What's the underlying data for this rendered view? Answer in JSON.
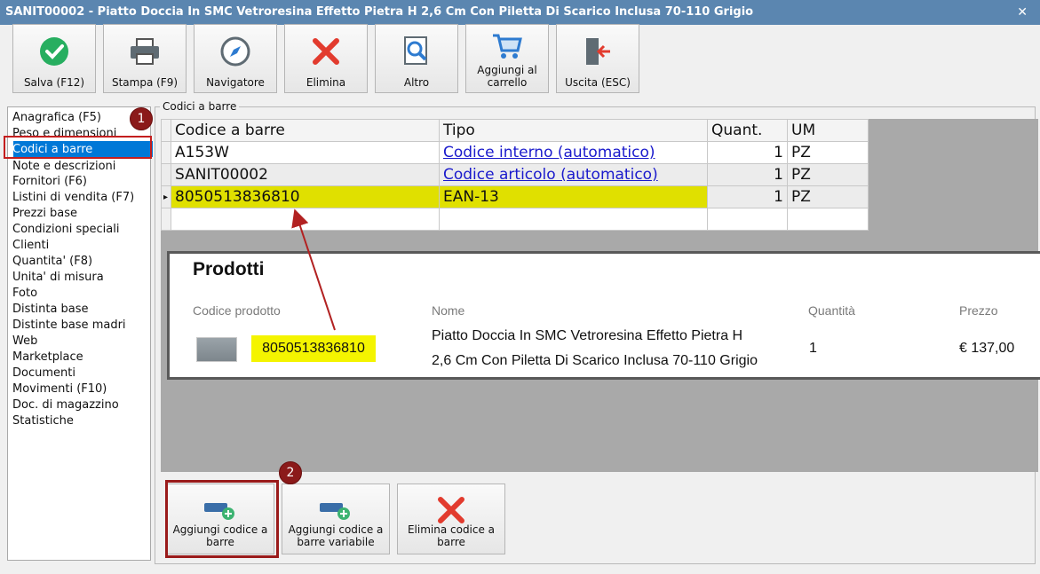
{
  "window": {
    "title": "SANIT00002 - Piatto Doccia In SMC Vetroresina Effetto Pietra H 2,6 Cm Con Piletta Di Scarico Inclusa 70-110 Grigio",
    "close_glyph": "✕"
  },
  "toolbar": {
    "save": "Salva (F12)",
    "print": "Stampa (F9)",
    "navigator": "Navigatore",
    "delete": "Elimina",
    "other": "Altro",
    "add_cart_line1": "Aggiungi al",
    "add_cart_line2": "carrello",
    "exit": "Uscita (ESC)"
  },
  "sidebar": {
    "items": [
      "Anagrafica (F5)",
      "Peso e dimensioni",
      "Codici a barre",
      "Note e descrizioni",
      "Fornitori (F6)",
      "Listini di vendita (F7)",
      "Prezzi base",
      "Condizioni speciali",
      "Clienti",
      "Quantita' (F8)",
      "Unita' di misura",
      "Foto",
      "Distinta base",
      "Distinte base madri",
      "Web",
      "Marketplace",
      "Documenti",
      "Movimenti (F10)",
      "Doc. di magazzino",
      "Statistiche"
    ],
    "selected": "Codici a barre"
  },
  "badges": {
    "one": "1",
    "two": "2"
  },
  "group": {
    "title": "Codici a barre"
  },
  "grid": {
    "columns": [
      "Codice a barre",
      "Tipo",
      "Quant.",
      "UM"
    ],
    "rows": [
      {
        "code": "A153W",
        "type": "Codice interno (automatico)",
        "qty": "1",
        "um": "PZ"
      },
      {
        "code": "SANIT00002",
        "type": "Codice articolo (automatico)",
        "qty": "1",
        "um": "PZ"
      },
      {
        "code": "8050513836810",
        "type": "EAN-13",
        "qty": "1",
        "um": "PZ"
      }
    ],
    "current_marker": "▸"
  },
  "products_panel": {
    "title": "Prodotti",
    "headers": {
      "code": "Codice prodotto",
      "name": "Nome",
      "qty": "Quantità",
      "price": "Prezzo"
    },
    "row": {
      "code": "8050513836810",
      "name_line1": "Piatto Doccia In SMC Vetroresina Effetto Pietra H",
      "name_line2": "2,6 Cm Con Piletta Di Scarico Inclusa 70-110 Grigio",
      "qty": "1",
      "price": "€ 137,00"
    }
  },
  "bottom_buttons": {
    "add_barcode_line1": "Aggiungi codice a",
    "add_barcode_line2": "barre",
    "add_variable_line1": "Aggiungi codice a",
    "add_variable_line2": "barre variabile",
    "delete_line1": "Elimina codice a",
    "delete_line2": "barre"
  },
  "colors": {
    "accent_red": "#c41e1e",
    "highlight_yellow": "#e0e000",
    "selection_blue": "#0078d7",
    "titlebar": "#5b86b0"
  }
}
